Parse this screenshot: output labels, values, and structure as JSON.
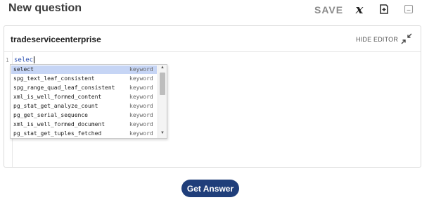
{
  "header": {
    "title": "New question",
    "save_label": "SAVE",
    "icons": [
      "function-x-icon",
      "add-card-icon",
      "minimize-icon"
    ]
  },
  "editor": {
    "connection_name": "tradeserviceenterprise",
    "hide_label": "HIDE EDITOR",
    "line_number": "1",
    "code": "selec"
  },
  "autocomplete": {
    "items": [
      {
        "name": "select",
        "kind": "keyword",
        "selected": true
      },
      {
        "name": "spg_text_leaf_consistent",
        "kind": "keyword"
      },
      {
        "name": "spg_range_quad_leaf_consistent",
        "kind": "keyword"
      },
      {
        "name": "xml_is_well_formed_content",
        "kind": "keyword"
      },
      {
        "name": "pg_stat_get_analyze_count",
        "kind": "keyword"
      },
      {
        "name": "pg_get_serial_sequence",
        "kind": "keyword"
      },
      {
        "name": "xml_is_well_formed_document",
        "kind": "keyword"
      },
      {
        "name": "pg_stat_get_tuples_fetched",
        "kind": "keyword"
      }
    ]
  },
  "footer": {
    "answer_label": "Get Answer"
  },
  "colors": {
    "primary": "#1f3e7a",
    "selection": "#c6d5f5",
    "code": "#2a4fb0"
  }
}
